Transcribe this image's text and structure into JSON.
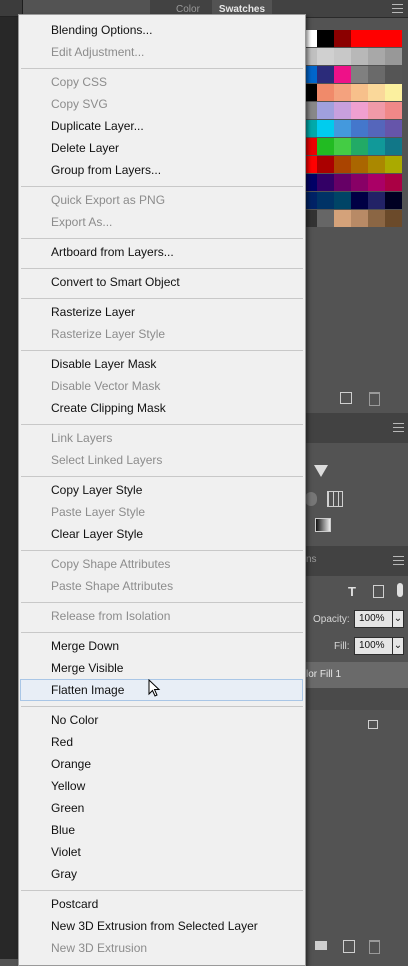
{
  "panel": {
    "tabs": [
      "Color",
      "Swatches"
    ],
    "active_tab": "Swatches",
    "opacity_label": "Opacity:",
    "opacity_value": "100%",
    "fill_label": "Fill:",
    "fill_value": "100%",
    "layer_name": "lor Fill 1",
    "tab_fragment": "ns"
  },
  "swatch_colors": [
    [
      "#ffffff",
      "#000000",
      "#8b0000",
      "#ff0000",
      "#ff0000",
      "#ff0000"
    ],
    [
      "#c0c0c0",
      "#d0d0d0",
      "#c8c8c8",
      "#b8b8b8",
      "#a8a8a8",
      "#989898"
    ],
    [
      "#0066cc",
      "#2b2b7a",
      "#ee1188",
      "#808080",
      "#6a6a6a",
      "#555555"
    ],
    [
      "#000000",
      "#f08a6a",
      "#f4a27e",
      "#f7c08b",
      "#fad89a",
      "#fbf09f"
    ],
    [
      "#888888",
      "#a0a0dd",
      "#c8a0dd",
      "#f0a0d0",
      "#f09aa8",
      "#f08888"
    ],
    [
      "#00aaaa",
      "#00ccee",
      "#4499dd",
      "#4477cc",
      "#5566bb",
      "#6655aa"
    ],
    [
      "#ee0000",
      "#22bb22",
      "#44cc44",
      "#22aa66",
      "#119999",
      "#117788"
    ],
    [
      "#ff0000",
      "#aa0000",
      "#aa4400",
      "#aa6600",
      "#aa8800",
      "#aaaa00"
    ],
    [
      "#000066",
      "#330066",
      "#660066",
      "#880066",
      "#aa0066",
      "#aa0044"
    ],
    [
      "#002266",
      "#003366",
      "#004466",
      "#000044",
      "#222266",
      "#000022"
    ],
    [
      "#333333",
      "#666666",
      "#d4a27a",
      "#b88a66",
      "#8b6644",
      "#6b4a2a"
    ]
  ],
  "menu": [
    {
      "label": "Blending Options...",
      "disabled": false
    },
    {
      "label": "Edit Adjustment...",
      "disabled": true
    },
    {
      "sep": true
    },
    {
      "label": "Copy CSS",
      "disabled": true
    },
    {
      "label": "Copy SVG",
      "disabled": true
    },
    {
      "label": "Duplicate Layer...",
      "disabled": false
    },
    {
      "label": "Delete Layer",
      "disabled": false
    },
    {
      "label": "Group from Layers...",
      "disabled": false
    },
    {
      "sep": true
    },
    {
      "label": "Quick Export as PNG",
      "disabled": true
    },
    {
      "label": "Export As...",
      "disabled": true
    },
    {
      "sep": true
    },
    {
      "label": "Artboard from Layers...",
      "disabled": false
    },
    {
      "sep": true
    },
    {
      "label": "Convert to Smart Object",
      "disabled": false
    },
    {
      "sep": true
    },
    {
      "label": "Rasterize Layer",
      "disabled": false
    },
    {
      "label": "Rasterize Layer Style",
      "disabled": true
    },
    {
      "sep": true
    },
    {
      "label": "Disable Layer Mask",
      "disabled": false
    },
    {
      "label": "Disable Vector Mask",
      "disabled": true
    },
    {
      "label": "Create Clipping Mask",
      "disabled": false
    },
    {
      "sep": true
    },
    {
      "label": "Link Layers",
      "disabled": true
    },
    {
      "label": "Select Linked Layers",
      "disabled": true
    },
    {
      "sep": true
    },
    {
      "label": "Copy Layer Style",
      "disabled": false
    },
    {
      "label": "Paste Layer Style",
      "disabled": true
    },
    {
      "label": "Clear Layer Style",
      "disabled": false
    },
    {
      "sep": true
    },
    {
      "label": "Copy Shape Attributes",
      "disabled": true
    },
    {
      "label": "Paste Shape Attributes",
      "disabled": true
    },
    {
      "sep": true
    },
    {
      "label": "Release from Isolation",
      "disabled": true
    },
    {
      "sep": true
    },
    {
      "label": "Merge Down",
      "disabled": false
    },
    {
      "label": "Merge Visible",
      "disabled": false
    },
    {
      "label": "Flatten Image",
      "disabled": false,
      "highlighted": true
    },
    {
      "sep": true
    },
    {
      "label": "No Color",
      "disabled": false
    },
    {
      "label": "Red",
      "disabled": false
    },
    {
      "label": "Orange",
      "disabled": false
    },
    {
      "label": "Yellow",
      "disabled": false
    },
    {
      "label": "Green",
      "disabled": false
    },
    {
      "label": "Blue",
      "disabled": false
    },
    {
      "label": "Violet",
      "disabled": false
    },
    {
      "label": "Gray",
      "disabled": false
    },
    {
      "sep": true
    },
    {
      "label": "Postcard",
      "disabled": false
    },
    {
      "label": "New 3D Extrusion from Selected Layer",
      "disabled": false
    },
    {
      "label": "New 3D Extrusion",
      "disabled": true
    }
  ]
}
